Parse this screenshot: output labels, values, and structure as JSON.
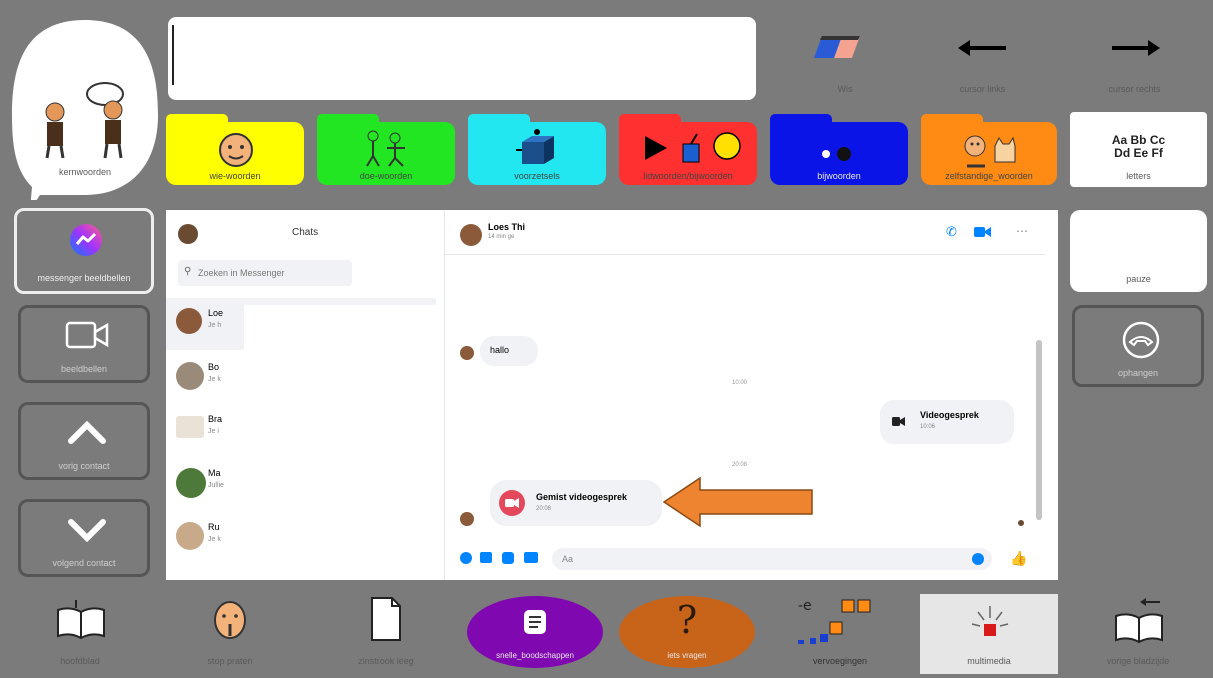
{
  "top": {
    "kernwoorden": "kernwoorden",
    "text_value": "",
    "wis_label": "Wis",
    "cursor_left": "cursor links",
    "cursor_right": "cursor rechts"
  },
  "folders": [
    {
      "label": "wie-woorden",
      "color": "#ffff00"
    },
    {
      "label": "doe-woorden",
      "color": "#22e622"
    },
    {
      "label": "voorzetsels",
      "color": "#22e6f0"
    },
    {
      "label": "lidwoorden/bijwoorden",
      "color": "#ff3030"
    },
    {
      "label": "bijwoorden",
      "color": "#0a14e6"
    },
    {
      "label": "zelfstandige_woorden",
      "color": "#ff8a14"
    }
  ],
  "letters": {
    "line1": "Aa Bb Cc",
    "line2": "Dd Ee Ff",
    "label": "letters"
  },
  "left": {
    "messenger": "messenger beeldbellen",
    "beeldbellen": "beeldbellen",
    "vorig": "vorig contact",
    "volgend": "volgend contact"
  },
  "right": {
    "pauze": "pauze",
    "ophangen": "ophangen"
  },
  "messenger": {
    "chats_title": "Chats",
    "search_placeholder": "Zoeken in Messenger",
    "contacts": [
      {
        "name": "Loe",
        "sub": "Je h"
      },
      {
        "name": "Bo",
        "sub": "Je k"
      },
      {
        "name": "Bra",
        "sub": "Je i"
      },
      {
        "name": "Ma",
        "sub": "Jullie"
      },
      {
        "name": "Ru",
        "sub": "Je k"
      }
    ],
    "conversation_name": "Loes Thi",
    "conversation_sub": "14 min ge",
    "msg_hallo": "hallo",
    "time1": "10:00",
    "video_title": "Videogesprek",
    "video_sub": "10:06",
    "time2": "20:08",
    "missed_title": "Gemist videogesprek",
    "missed_sub": "20:08",
    "compose_placeholder": "Aa"
  },
  "bottom": {
    "hoofdblad": "hoofdblad",
    "stop": "stop praten",
    "zinstrook": "zinstrook leeg",
    "snelle": "snelle_boodschappen",
    "iets": "iets vragen",
    "vervoegingen": "vervoegingen",
    "multimedia": "multimedia",
    "vorige": "vorige bladzijde"
  }
}
